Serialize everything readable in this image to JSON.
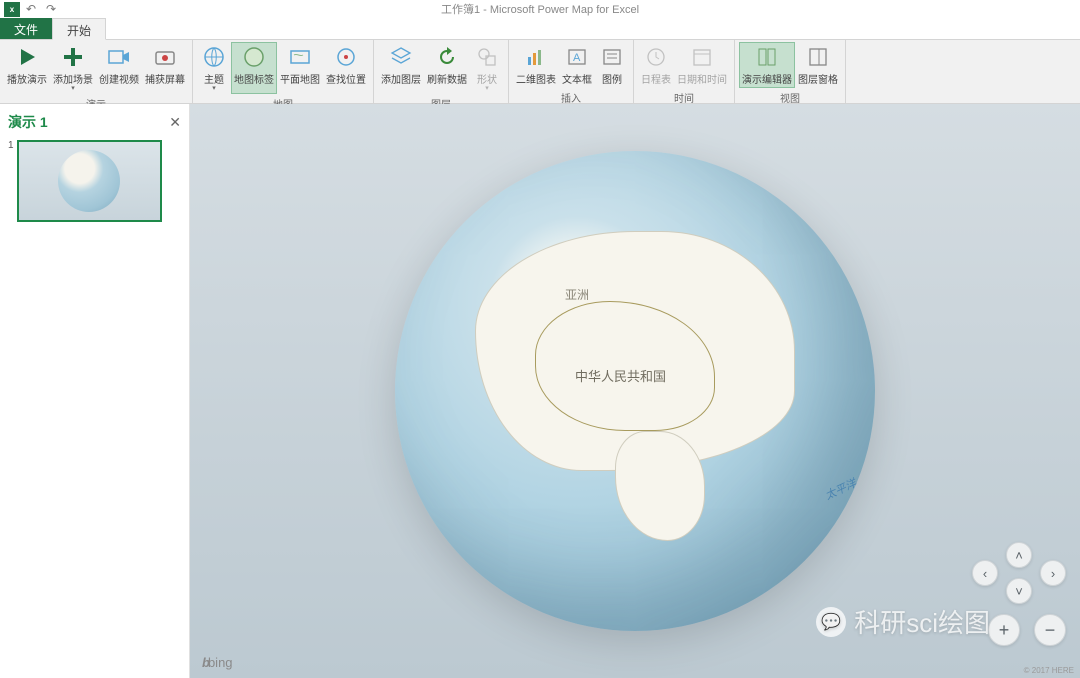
{
  "title": "工作簿1 - Microsoft Power Map for Excel",
  "qat": {
    "app": "x"
  },
  "tabs": {
    "file": "文件",
    "home": "开始"
  },
  "ribbon": {
    "groups": {
      "demo": {
        "label": "演示",
        "play": "播放演示",
        "addScene": "添加场景",
        "createVideo": "创建视频",
        "capture": "捕获屏幕"
      },
      "map": {
        "label": "地图",
        "theme": "主题",
        "mapLabel": "地图标签",
        "flatMap": "平面地图",
        "findLoc": "查找位置"
      },
      "layer": {
        "label": "图层",
        "addLayer": "添加图层",
        "refresh": "刷新数据",
        "shape": "形状"
      },
      "insert": {
        "label": "插入",
        "chart2d": "二维图表",
        "textbox": "文本框",
        "legend": "图例"
      },
      "time": {
        "label": "时间",
        "timeline": "日程表",
        "datetime": "日期和时间"
      },
      "view": {
        "label": "视图",
        "tourEditor": "演示编辑器",
        "layerPane": "图层窗格"
      }
    }
  },
  "panel": {
    "title": "演示 1",
    "close": "✕",
    "thumbNum": "1"
  },
  "globe": {
    "asia": "亚洲",
    "china": "中华人民共和国",
    "ocean": "太平洋"
  },
  "footer": {
    "bing_b": "b",
    "bing_text": "bing",
    "copyright": "© 2017 HERE"
  },
  "watermark": {
    "text": "科研sci绘图"
  }
}
